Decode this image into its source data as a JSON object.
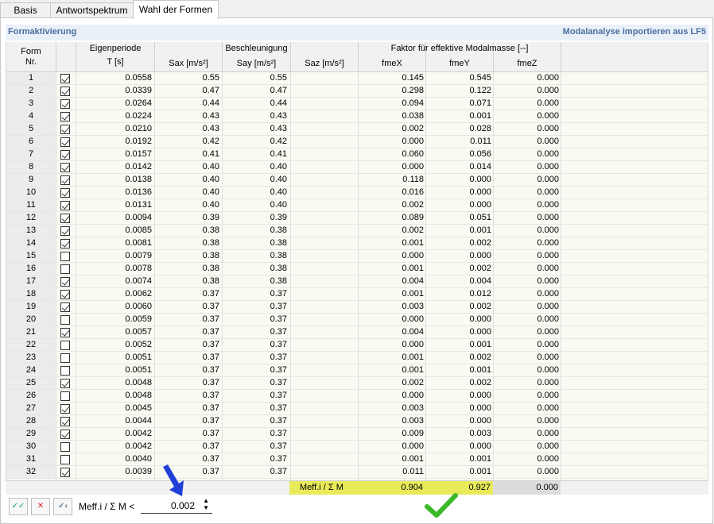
{
  "tabs": [
    {
      "label": "Basis"
    },
    {
      "label": "Antwortspektrum"
    },
    {
      "label": "Wahl der Formen"
    }
  ],
  "section": {
    "title": "Formaktivierung",
    "link": "Modalanalyse importieren aus LF5"
  },
  "header": {
    "form": "Form",
    "nr": "Nr.",
    "eigen": "Eigenperiode",
    "t": "T [s]",
    "besch": "Beschleunigung",
    "sax": "Sax [m/s²]",
    "say": "Say [m/s²]",
    "saz": "Saz [m/s²]",
    "faktor": "Faktor für effektive Modalmasse [--]",
    "fmex": "fmeX",
    "fmey": "fmeY",
    "fmez": "fmeZ"
  },
  "rows": [
    {
      "nr": "1",
      "on": true,
      "t": "0.0558",
      "sax": "0.55",
      "say": "0.55",
      "fx": "0.145",
      "fy": "0.545",
      "fz": "0.000"
    },
    {
      "nr": "2",
      "on": true,
      "t": "0.0339",
      "sax": "0.47",
      "say": "0.47",
      "fx": "0.298",
      "fy": "0.122",
      "fz": "0.000"
    },
    {
      "nr": "3",
      "on": true,
      "t": "0.0264",
      "sax": "0.44",
      "say": "0.44",
      "fx": "0.094",
      "fy": "0.071",
      "fz": "0.000"
    },
    {
      "nr": "4",
      "on": true,
      "t": "0.0224",
      "sax": "0.43",
      "say": "0.43",
      "fx": "0.038",
      "fy": "0.001",
      "fz": "0.000"
    },
    {
      "nr": "5",
      "on": true,
      "t": "0.0210",
      "sax": "0.43",
      "say": "0.43",
      "fx": "0.002",
      "fy": "0.028",
      "fz": "0.000"
    },
    {
      "nr": "6",
      "on": true,
      "t": "0.0192",
      "sax": "0.42",
      "say": "0.42",
      "fx": "0.000",
      "fy": "0.011",
      "fz": "0.000"
    },
    {
      "nr": "7",
      "on": true,
      "t": "0.0157",
      "sax": "0.41",
      "say": "0.41",
      "fx": "0.060",
      "fy": "0.056",
      "fz": "0.000"
    },
    {
      "nr": "8",
      "on": true,
      "t": "0.0142",
      "sax": "0.40",
      "say": "0.40",
      "fx": "0.000",
      "fy": "0.014",
      "fz": "0.000"
    },
    {
      "nr": "9",
      "on": true,
      "t": "0.0138",
      "sax": "0.40",
      "say": "0.40",
      "fx": "0.118",
      "fy": "0.000",
      "fz": "0.000"
    },
    {
      "nr": "10",
      "on": true,
      "t": "0.0136",
      "sax": "0.40",
      "say": "0.40",
      "fx": "0.016",
      "fy": "0.000",
      "fz": "0.000"
    },
    {
      "nr": "11",
      "on": true,
      "t": "0.0131",
      "sax": "0.40",
      "say": "0.40",
      "fx": "0.002",
      "fy": "0.000",
      "fz": "0.000"
    },
    {
      "nr": "12",
      "on": true,
      "t": "0.0094",
      "sax": "0.39",
      "say": "0.39",
      "fx": "0.089",
      "fy": "0.051",
      "fz": "0.000"
    },
    {
      "nr": "13",
      "on": true,
      "t": "0.0085",
      "sax": "0.38",
      "say": "0.38",
      "fx": "0.002",
      "fy": "0.001",
      "fz": "0.000"
    },
    {
      "nr": "14",
      "on": true,
      "t": "0.0081",
      "sax": "0.38",
      "say": "0.38",
      "fx": "0.001",
      "fy": "0.002",
      "fz": "0.000"
    },
    {
      "nr": "15",
      "on": false,
      "t": "0.0079",
      "sax": "0.38",
      "say": "0.38",
      "fx": "0.000",
      "fy": "0.000",
      "fz": "0.000"
    },
    {
      "nr": "16",
      "on": false,
      "t": "0.0078",
      "sax": "0.38",
      "say": "0.38",
      "fx": "0.001",
      "fy": "0.002",
      "fz": "0.000"
    },
    {
      "nr": "17",
      "on": true,
      "t": "0.0074",
      "sax": "0.38",
      "say": "0.38",
      "fx": "0.004",
      "fy": "0.004",
      "fz": "0.000"
    },
    {
      "nr": "18",
      "on": true,
      "t": "0.0062",
      "sax": "0.37",
      "say": "0.37",
      "fx": "0.001",
      "fy": "0.012",
      "fz": "0.000"
    },
    {
      "nr": "19",
      "on": true,
      "t": "0.0060",
      "sax": "0.37",
      "say": "0.37",
      "fx": "0.003",
      "fy": "0.002",
      "fz": "0.000"
    },
    {
      "nr": "20",
      "on": false,
      "t": "0.0059",
      "sax": "0.37",
      "say": "0.37",
      "fx": "0.000",
      "fy": "0.000",
      "fz": "0.000"
    },
    {
      "nr": "21",
      "on": true,
      "t": "0.0057",
      "sax": "0.37",
      "say": "0.37",
      "fx": "0.004",
      "fy": "0.000",
      "fz": "0.000"
    },
    {
      "nr": "22",
      "on": false,
      "t": "0.0052",
      "sax": "0.37",
      "say": "0.37",
      "fx": "0.000",
      "fy": "0.001",
      "fz": "0.000"
    },
    {
      "nr": "23",
      "on": false,
      "t": "0.0051",
      "sax": "0.37",
      "say": "0.37",
      "fx": "0.001",
      "fy": "0.002",
      "fz": "0.000"
    },
    {
      "nr": "24",
      "on": false,
      "t": "0.0051",
      "sax": "0.37",
      "say": "0.37",
      "fx": "0.001",
      "fy": "0.001",
      "fz": "0.000"
    },
    {
      "nr": "25",
      "on": true,
      "t": "0.0048",
      "sax": "0.37",
      "say": "0.37",
      "fx": "0.002",
      "fy": "0.002",
      "fz": "0.000"
    },
    {
      "nr": "26",
      "on": false,
      "t": "0.0048",
      "sax": "0.37",
      "say": "0.37",
      "fx": "0.000",
      "fy": "0.000",
      "fz": "0.000"
    },
    {
      "nr": "27",
      "on": true,
      "t": "0.0045",
      "sax": "0.37",
      "say": "0.37",
      "fx": "0.003",
      "fy": "0.000",
      "fz": "0.000"
    },
    {
      "nr": "28",
      "on": true,
      "t": "0.0044",
      "sax": "0.37",
      "say": "0.37",
      "fx": "0.003",
      "fy": "0.000",
      "fz": "0.000"
    },
    {
      "nr": "29",
      "on": true,
      "t": "0.0042",
      "sax": "0.37",
      "say": "0.37",
      "fx": "0.009",
      "fy": "0.003",
      "fz": "0.000"
    },
    {
      "nr": "30",
      "on": false,
      "t": "0.0042",
      "sax": "0.37",
      "say": "0.37",
      "fx": "0.000",
      "fy": "0.000",
      "fz": "0.000"
    },
    {
      "nr": "31",
      "on": false,
      "t": "0.0040",
      "sax": "0.37",
      "say": "0.37",
      "fx": "0.001",
      "fy": "0.001",
      "fz": "0.000"
    },
    {
      "nr": "32",
      "on": true,
      "t": "0.0039",
      "sax": "0.37",
      "say": "0.37",
      "fx": "0.011",
      "fy": "0.001",
      "fz": "0.000"
    }
  ],
  "footer": {
    "label": "Meff.i / Σ M",
    "fx": "0.904",
    "fy": "0.927",
    "fz": "0.000"
  },
  "bottom": {
    "label": "Meff.i / Σ M <",
    "value": "0.002"
  },
  "colors": {
    "highlight": "#e8ea5a",
    "arrow": "#1f3fd8",
    "check": "#3cb82a"
  }
}
